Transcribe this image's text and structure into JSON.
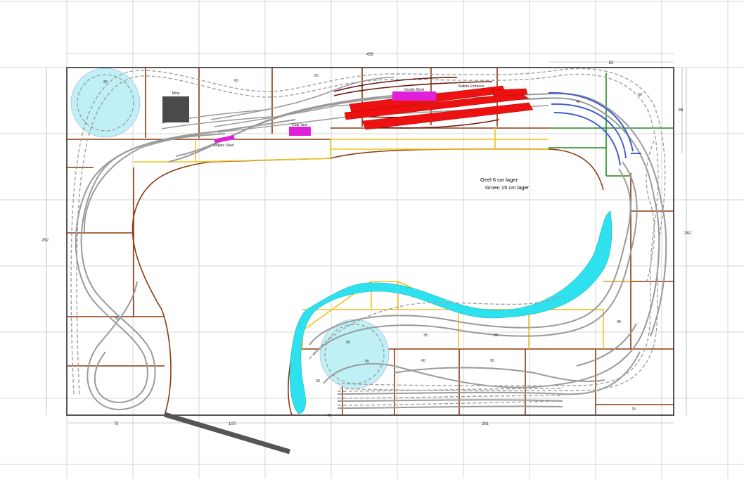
{
  "notes": {
    "geel": "Geel 6 cm lager",
    "groen": "Groen 15 cm lager"
  },
  "labels": {
    "mine": "Mine",
    "goods_shed": "Goods Shed",
    "station_building": "Station Entrance",
    "coal": "Coal Yard",
    "engine": "Engine Shed"
  },
  "dimensions": {
    "top_total": "458",
    "top_right": "83",
    "right_top": "88",
    "left_total": "262",
    "right_total": "262",
    "bottom_left": "75",
    "bottom_mid": "100",
    "bottom_right": "281",
    "d_80": "80",
    "d_60a": "60",
    "d_60b": "60",
    "d_40": "40",
    "d_60c": "60",
    "d_65": "65",
    "d_55": "55",
    "d_85": "85",
    "d_33": "33",
    "d_70": "70",
    "d_38": "38",
    "d_50a": "50",
    "d_50b": "50",
    "d_60d": "60",
    "d_90": "90",
    "d_75": "75"
  },
  "colors": {
    "baseboard": "#8b3a0e",
    "track": "#9a9a9a",
    "yellow_grade": "#f2c21b",
    "green_grade": "#1e8a1e",
    "blue_track": "#4060c8",
    "water": "#2de2ee",
    "turntable": "#bff0f5",
    "platform": "#ee1111",
    "building": "#e020d8",
    "frame": "#555555"
  }
}
